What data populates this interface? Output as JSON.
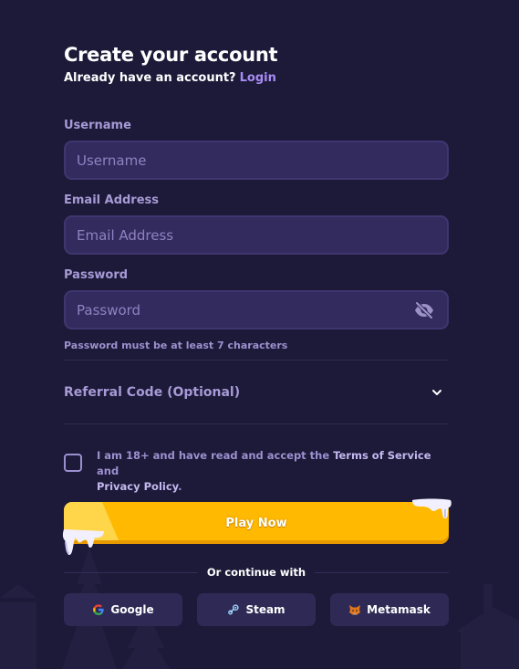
{
  "header": {
    "title": "Create your account",
    "subtitle_prefix": "Already have an account?",
    "login_link": "Login"
  },
  "form": {
    "username": {
      "label": "Username",
      "placeholder": "Username",
      "value": ""
    },
    "email": {
      "label": "Email Address",
      "placeholder": "Email Address",
      "value": ""
    },
    "password": {
      "label": "Password",
      "placeholder": "Password",
      "value": "",
      "hint": "Password must be at least 7 characters",
      "visibility_icon": "eye-off-icon"
    },
    "referral": {
      "label": "Referral Code (Optional)",
      "expanded": false,
      "icon": "chevron-down-icon"
    },
    "terms": {
      "checked": false,
      "text_prefix": "I am 18+ and have read and accept the",
      "terms_link": "Terms of Service",
      "text_mid": "and",
      "privacy_link": "Privacy Policy",
      "text_suffix": "."
    },
    "submit_label": "Play Now"
  },
  "social": {
    "divider_text": "Or continue with",
    "buttons": [
      {
        "label": "Google",
        "icon": "google-icon"
      },
      {
        "label": "Steam",
        "icon": "steam-icon"
      },
      {
        "label": "Metamask",
        "icon": "metamask-icon"
      }
    ]
  },
  "colors": {
    "background": "#1c1a38",
    "input_bg": "#332b5e",
    "accent_link": "#a98bf5",
    "play_button": "#ffb900",
    "label": "#a79ad6"
  }
}
